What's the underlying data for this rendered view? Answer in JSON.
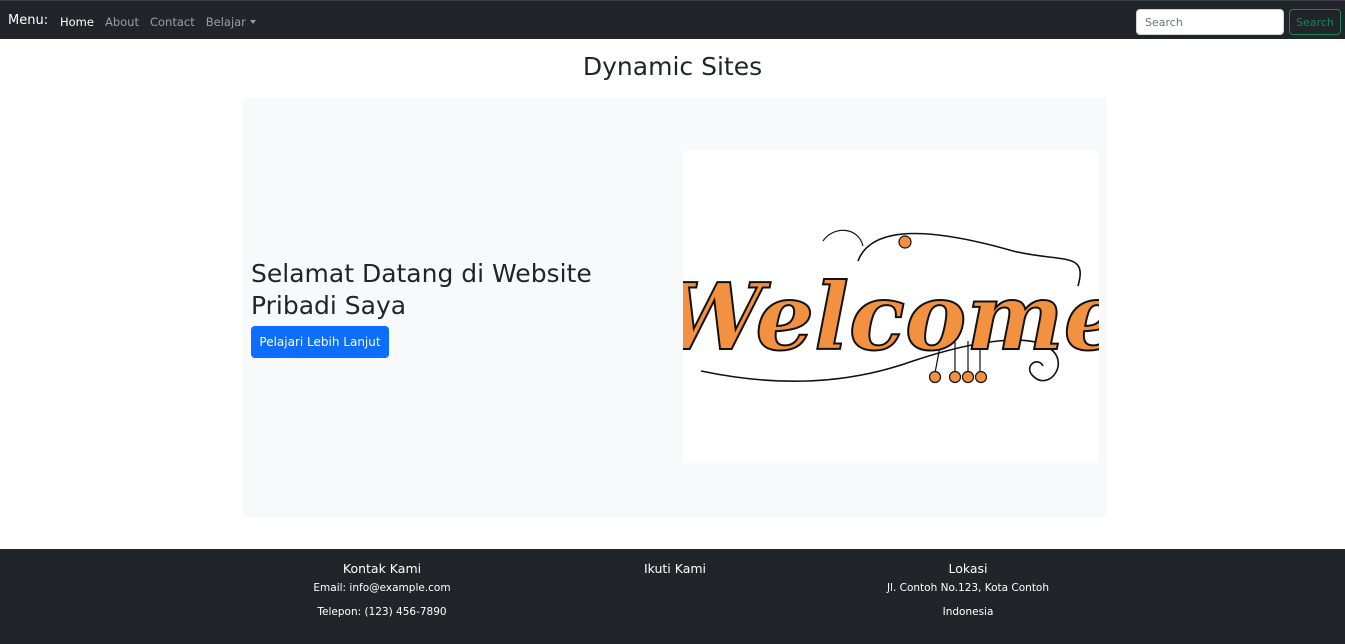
{
  "navbar": {
    "brand": "Menu:",
    "links": [
      {
        "label": "Home"
      },
      {
        "label": "About"
      },
      {
        "label": "Contact"
      },
      {
        "label": "Belajar"
      }
    ],
    "search_placeholder": "Search",
    "search_button": "Search"
  },
  "page": {
    "title": "Dynamic Sites"
  },
  "hero": {
    "heading": "Selamat Datang di Website Pribadi Saya",
    "button": "Pelajari Lebih Lanjut",
    "image_text": "Welcome"
  },
  "footer": {
    "contact": {
      "title": "Kontak Kami",
      "email": "Email: info@example.com",
      "phone": "Telepon: (123) 456-7890"
    },
    "follow": {
      "title": "Ikuti Kami"
    },
    "location": {
      "title": "Lokasi",
      "address": "Jl. Contoh No.123, Kota Contoh",
      "country": "Indonesia"
    }
  },
  "colors": {
    "navbar_bg": "#212529",
    "hero_bg": "#f8f9fa",
    "primary": "#0d6efd",
    "success": "#198754",
    "welcome_fill": "#f2913f"
  }
}
